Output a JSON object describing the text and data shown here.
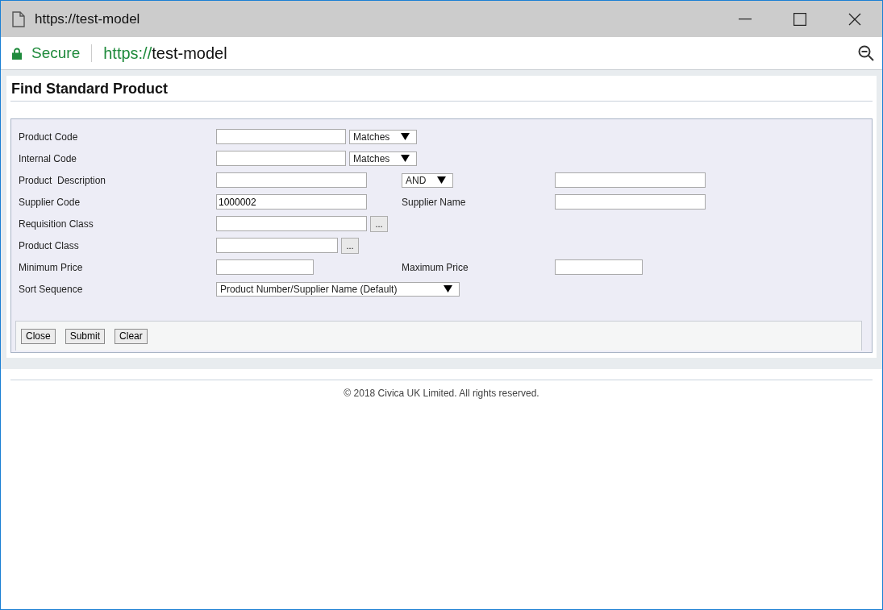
{
  "window": {
    "title": "https://test-model"
  },
  "address_bar": {
    "security": "Secure",
    "scheme": "https://",
    "host": "test-model"
  },
  "page": {
    "title": "Find Standard Product"
  },
  "form": {
    "rows": [
      {
        "label": "Product Code",
        "input": {
          "kind": "text"
        },
        "addon": {
          "kind": "select",
          "value": "Matches"
        }
      },
      {
        "label": "Internal Code",
        "input": {
          "kind": "text"
        },
        "addon": {
          "kind": "select",
          "value": "Matches"
        }
      },
      {
        "label": "Product  Description",
        "input": {
          "kind": "text"
        },
        "right": {
          "kind": "select",
          "value": "AND"
        },
        "right_input": {
          "kind": "text"
        }
      },
      {
        "label": "Supplier Code",
        "input": {
          "kind": "text",
          "value": "1000002"
        },
        "right": {
          "kind": "label",
          "value": "Supplier Name"
        },
        "right_input": {
          "kind": "text"
        }
      },
      {
        "label": "Requisition Class",
        "input": {
          "kind": "text"
        },
        "addon": {
          "kind": "lookup",
          "value": "..."
        }
      },
      {
        "label": "Product Class",
        "input": {
          "kind": "text"
        },
        "addon": {
          "kind": "lookup",
          "value": "..."
        }
      },
      {
        "label": "Minimum Price",
        "input": {
          "kind": "text"
        },
        "right": {
          "kind": "label",
          "value": "Maximum Price"
        },
        "right_input": {
          "kind": "text"
        }
      },
      {
        "label": "Sort Sequence",
        "input": {
          "kind": "select",
          "value": "Product Number/Supplier Name (Default)"
        }
      }
    ],
    "buttons": [
      "Close",
      "Submit",
      "Clear"
    ]
  },
  "footer": "© 2018 Civica UK Limited. All rights reserved."
}
